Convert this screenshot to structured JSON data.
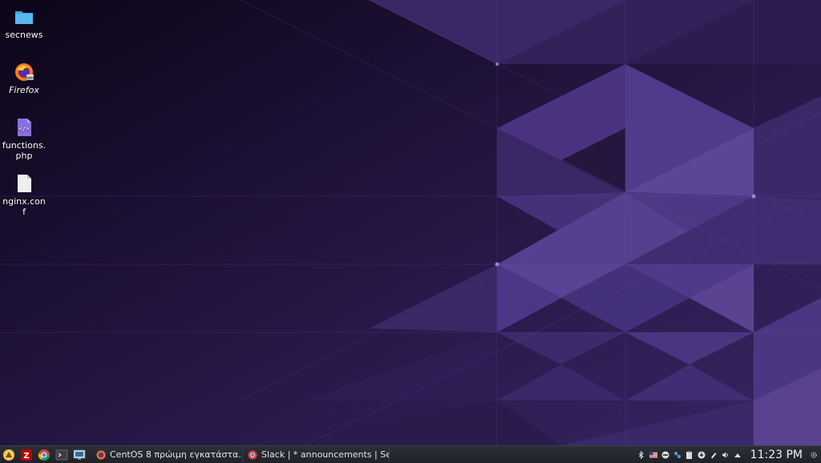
{
  "desktop": {
    "icons": [
      {
        "label": "secnews",
        "icon": "folder-icon"
      },
      {
        "label": "Firefox",
        "icon": "firefox-icon"
      },
      {
        "label": "functions.\nphp",
        "icon": "php-file-icon"
      },
      {
        "label": "nginx.con\nf",
        "icon": "text-file-icon"
      }
    ]
  },
  "taskbar": {
    "launchers": [
      "kde-menu-icon",
      "filezilla-icon",
      "chrome-icon",
      "terminal-icon",
      "system-monitor-icon"
    ],
    "tasks": [
      {
        "label": "CentOS 8 πρώιμη εγκατάστα…",
        "icon": "firefox-icon"
      },
      {
        "label": "Slack | * announcements | Se…",
        "icon": "chrome-icon"
      }
    ],
    "tray_icons": [
      "bluetooth-icon",
      "us-flag-icon",
      "minus-circle-icon",
      "network-icon",
      "clipboard-icon",
      "download-icon",
      "notes-icon",
      "volume-icon",
      "expand-arrow-icon"
    ],
    "clock": "11:23 PM"
  },
  "colors": {
    "wallpaper_dark": "#140a26",
    "wallpaper_mid": "#3a2463",
    "wallpaper_light": "#5b3f8f",
    "taskbar": "#25282f"
  }
}
